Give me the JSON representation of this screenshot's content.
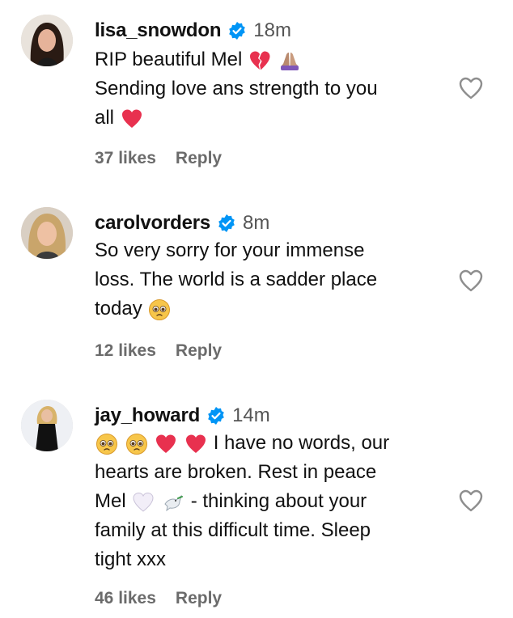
{
  "comments": [
    {
      "username": "lisa_snowdon",
      "time": "18m",
      "lines": [
        "RIP beautiful Mel",
        "Sending love ans strength to you",
        "all"
      ],
      "likes": "37 likes",
      "reply": "Reply",
      "line_emojis": [
        [
          "broken-heart",
          "folded-hands"
        ],
        [],
        [
          "red-heart"
        ]
      ]
    },
    {
      "username": "carolvorders",
      "time": "8m",
      "lines": [
        "So very sorry for your immense",
        "loss. The world is a sadder place",
        "today"
      ],
      "likes": "12 likes",
      "reply": "Reply",
      "line_emojis": [
        [],
        [],
        [
          "pleading-face"
        ]
      ]
    },
    {
      "username": "jay_howard",
      "time": "14m",
      "lines": [
        "I have no words, our",
        "hearts are broken. Rest in peace",
        "Mel",
        "- thinking about your",
        "family at this difficult time. Sleep",
        "tight xxx"
      ],
      "likes": "46 likes",
      "reply": "Reply",
      "line_emojis": [
        [
          "pleading-face",
          "pleading-face",
          "red-heart",
          "red-heart"
        ],
        [],
        [
          "white-heart",
          "dove"
        ],
        [],
        [],
        []
      ]
    }
  ],
  "colors": {
    "verified_blue": "#0095f6",
    "meta_gray": "#6b6b6b",
    "heart_outline": "#8e8e8e",
    "red_heart": "#e8314f"
  }
}
